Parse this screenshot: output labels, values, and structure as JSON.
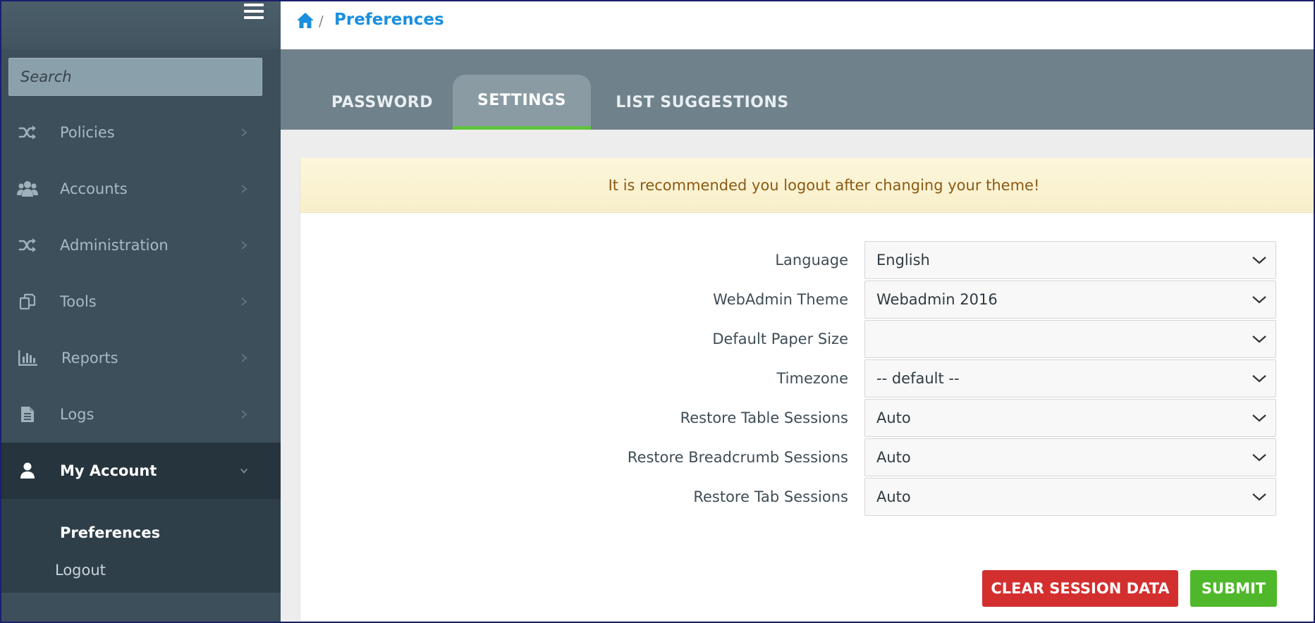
{
  "colors": {
    "sidebar_bg": "#3c4f5b",
    "sidebar_active_bg": "#26343d",
    "tabbar_bg": "#6f818a",
    "accent_blue": "#1a8fdf",
    "tab_active_underline": "#5fc33b",
    "alert_text": "#8a5a14",
    "clear_button": "#d32f2f",
    "submit_button": "#4fb82a"
  },
  "sidebar": {
    "search": {
      "placeholder": "Search",
      "value": ""
    },
    "items": [
      {
        "label": "Policies",
        "icon": "shuffle-icon"
      },
      {
        "label": "Accounts",
        "icon": "users-icon"
      },
      {
        "label": "Administration",
        "icon": "shuffle-icon"
      },
      {
        "label": "Tools",
        "icon": "copy-icon"
      },
      {
        "label": "Reports",
        "icon": "bar-chart-icon"
      },
      {
        "label": "Logs",
        "icon": "file-text-icon"
      },
      {
        "label": "My Account",
        "icon": "user-icon",
        "active": true
      }
    ],
    "submenu": [
      {
        "label": "Preferences",
        "current": true
      },
      {
        "label": "Logout"
      }
    ]
  },
  "header": {
    "breadcrumb_home_icon": "home-icon",
    "breadcrumb_separator": "/",
    "title": "Preferences"
  },
  "tabs": [
    {
      "label": "PASSWORD"
    },
    {
      "label": "SETTINGS",
      "active": true
    },
    {
      "label": "LIST SUGGESTIONS"
    }
  ],
  "alert": {
    "text": "It is recommended you logout after changing your theme!"
  },
  "form": {
    "fields": [
      {
        "label": "Language",
        "value": "English"
      },
      {
        "label": "WebAdmin Theme",
        "value": "Webadmin 2016"
      },
      {
        "label": "Default Paper Size",
        "value": ""
      },
      {
        "label": "Timezone",
        "value": "-- default --"
      },
      {
        "label": "Restore Table Sessions",
        "value": "Auto"
      },
      {
        "label": "Restore Breadcrumb Sessions",
        "value": "Auto"
      },
      {
        "label": "Restore Tab Sessions",
        "value": "Auto"
      }
    ],
    "clear_label": "CLEAR SESSION DATA",
    "submit_label": "SUBMIT"
  }
}
